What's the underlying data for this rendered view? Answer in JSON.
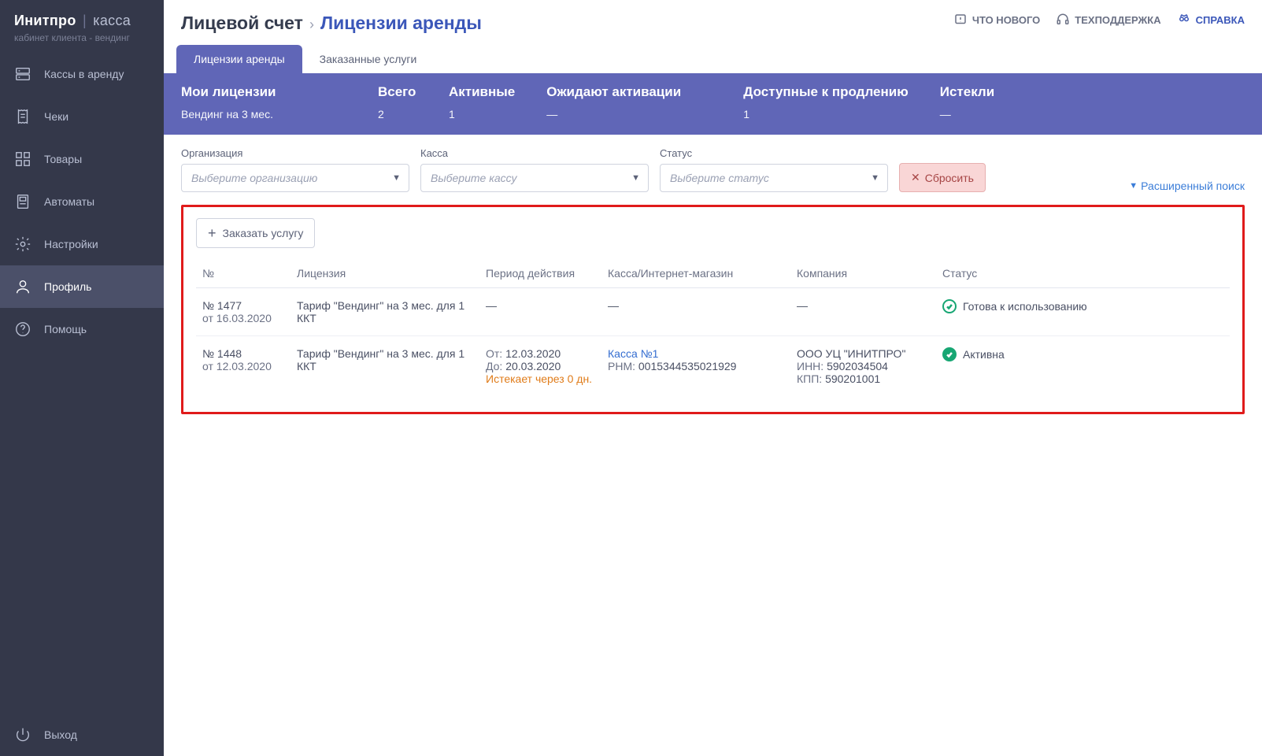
{
  "brand": {
    "name": "Инитпро",
    "product": "касса",
    "subtitle": "кабинет клиента - вендинг"
  },
  "sidebar": {
    "items": [
      "Кассы в аренду",
      "Чеки",
      "Товары",
      "Автоматы",
      "Настройки",
      "Профиль",
      "Помощь"
    ],
    "logout": "Выход"
  },
  "breadcrumb": {
    "root": "Лицевой счет",
    "current": "Лицензии аренды"
  },
  "toplinks": {
    "whatsnew": "ЧТО НОВОГО",
    "support": "ТЕХПОДДЕРЖКА",
    "help": "СПРАВКА"
  },
  "tabs": {
    "rent": "Лицензии аренды",
    "ordered": "Заказанные услуги"
  },
  "summary": {
    "my_label": "Мои лицензии",
    "my_val": "Вендинг на 3 мес.",
    "total_label": "Всего",
    "total_val": "2",
    "active_label": "Активные",
    "active_val": "1",
    "pending_label": "Ожидают активации",
    "pending_val": "—",
    "renew_label": "Доступные к продлению",
    "renew_val": "1",
    "expired_label": "Истекли",
    "expired_val": "—"
  },
  "filters": {
    "org_label": "Организация",
    "org_placeholder": "Выберите организацию",
    "kassa_label": "Касса",
    "kassa_placeholder": "Выберите кассу",
    "status_label": "Статус",
    "status_placeholder": "Выберите статус",
    "reset": "Сбросить",
    "advanced": "Расширенный поиск"
  },
  "actions": {
    "order": "Заказать услугу"
  },
  "table": {
    "headers": {
      "num": "№",
      "lic": "Лицензия",
      "period": "Период действия",
      "kassa": "Касса/Интернет-магазин",
      "company": "Компания",
      "status": "Статус"
    },
    "rows": [
      {
        "num_line1": "№ 1477",
        "num_line2": "от 16.03.2020",
        "lic": "Тариф \"Вендинг\" на 3 мес. для 1 ККТ",
        "period_from": "—",
        "period_to": "",
        "period_warn": "",
        "kassa_name": "—",
        "kassa_rnm_label": "",
        "kassa_rnm": "",
        "comp_name": "—",
        "comp_inn_label": "",
        "comp_inn": "",
        "comp_kpp_label": "",
        "comp_kpp": "",
        "status_text": "Готова к использованию",
        "status_filled": "false"
      },
      {
        "num_line1": "№ 1448",
        "num_line2": "от 12.03.2020",
        "lic": "Тариф \"Вендинг\" на 3 мес. для 1 ККТ",
        "period_from_label": "От:",
        "period_from": "12.03.2020",
        "period_to_label": "До:",
        "period_to": "20.03.2020",
        "period_warn": "Истекает через 0 дн.",
        "kassa_name": "Касса №1",
        "kassa_rnm_label": "РНМ:",
        "kassa_rnm": "0015344535021929",
        "comp_name": "ООО УЦ \"ИНИТПРО\"",
        "comp_inn_label": "ИНН:",
        "comp_inn": "5902034504",
        "comp_kpp_label": "КПП:",
        "comp_kpp": "590201001",
        "status_text": "Активна",
        "status_filled": "true"
      }
    ]
  }
}
